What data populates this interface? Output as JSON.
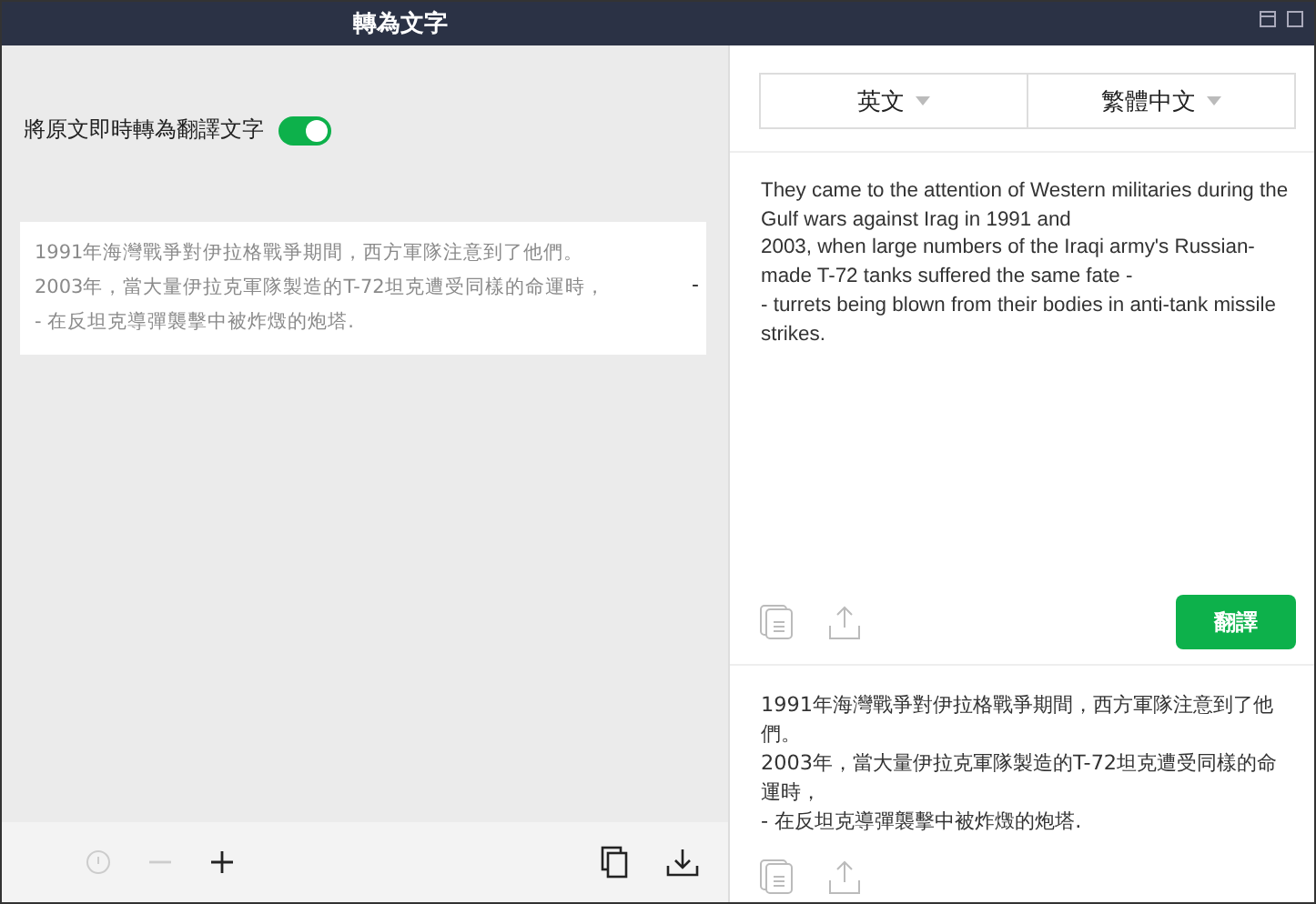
{
  "window": {
    "title": "轉為文字"
  },
  "left_panel": {
    "toggle": {
      "label": "將原文即時轉為翻譯文字",
      "on": true
    },
    "ocr_lines": [
      "1991年海灣戰爭對伊拉格戰爭期間，西方軍隊注意到了他們。",
      "2003年，當大量伊拉克軍隊製造的T-72坦克遭受同樣的命運時，",
      "- 在反坦克導彈襲擊中被炸燬的炮塔."
    ],
    "stray_mark": "-",
    "toolbar": [
      {
        "kind": "info",
        "disabled": true
      },
      {
        "kind": "minus",
        "disabled": true
      },
      {
        "kind": "plus",
        "disabled": false
      }
    ]
  },
  "right_panel": {
    "languages": [
      {
        "label": "英文"
      },
      {
        "label": "繁體中文"
      }
    ],
    "source_text": "They came to the attention of Western militaries during the Gulf wars against Irag in 1991 and\n2003, when large numbers of the Iraqi army's Russian-made T-72 tanks suffered the same fate -\n- turrets being blown from their bodies in anti-tank missile strikes.",
    "translate_button": "翻譯",
    "result_text": "1991年海灣戰爭對伊拉格戰爭期間，西方軍隊注意到了他們。\n2003年，當大量伊拉克軍隊製造的T-72坦克遭受同樣的命運時，\n- 在反坦克導彈襲擊中被炸燬的炮塔."
  }
}
